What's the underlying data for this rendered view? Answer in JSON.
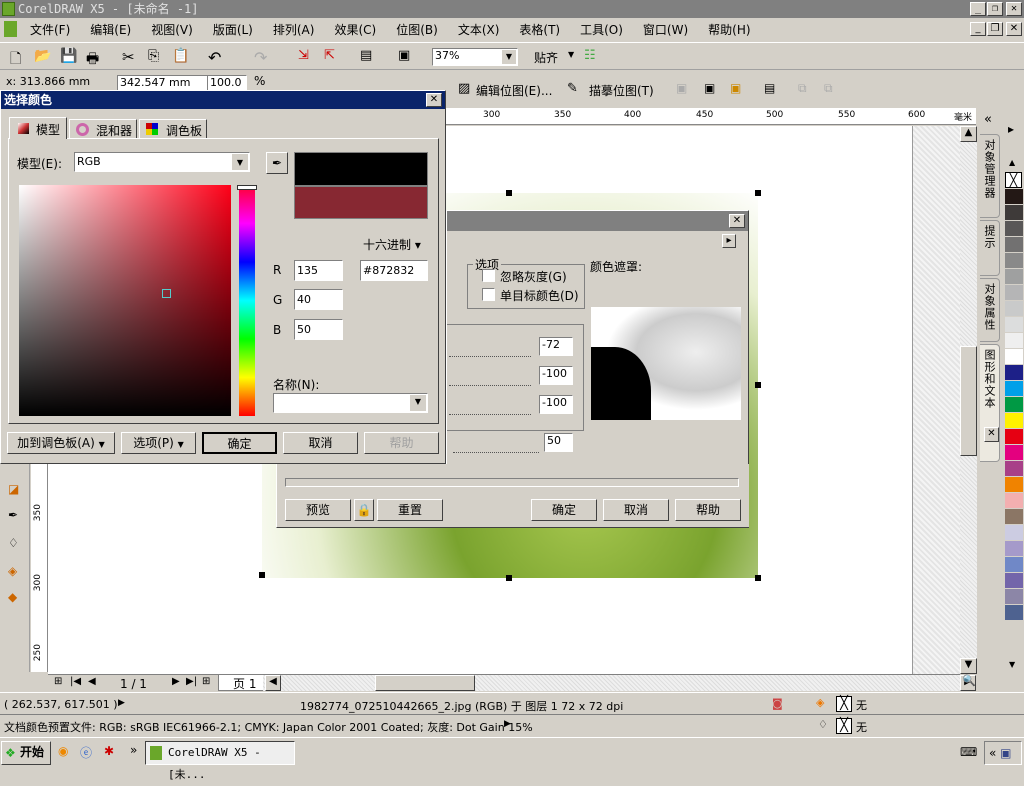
{
  "window": {
    "title": "CorelDRAW X5 - [未命名 -1]"
  },
  "menu": [
    "文件(F)",
    "编辑(E)",
    "视图(V)",
    "版面(L)",
    "排列(A)",
    "效果(C)",
    "位图(B)",
    "文本(X)",
    "表格(T)",
    "工具(O)",
    "窗口(W)",
    "帮助(H)"
  ],
  "toolbar": {
    "zoom": "37%",
    "snap": "贴齐"
  },
  "propbar": {
    "x": "x: 313.866 mm",
    "width": "342.547 mm",
    "scale": "100.0",
    "percent": "%",
    "edit_bitmap": "编辑位图(E)...",
    "trace_bitmap": "描摹位图(T)"
  },
  "ruler": {
    "top_ticks": [
      "300",
      "350",
      "400",
      "450",
      "500",
      "550",
      "600"
    ],
    "unit": "毫米",
    "left_ticks": [
      "350",
      "300",
      "250"
    ]
  },
  "color_dialog": {
    "title": "选择颜色",
    "tabs": [
      "模型",
      "混和器",
      "调色板"
    ],
    "model_label": "模型(E):",
    "model_value": "RGB",
    "hex_mode": "十六进制",
    "r_label": "R",
    "g_label": "G",
    "b_label": "B",
    "r": "135",
    "g": "40",
    "b": "50",
    "hex": "#872832",
    "name_label": "名称(N):",
    "name_value": "",
    "add_palette": "加到调色板(A)",
    "options": "选项(P)",
    "ok": "确定",
    "cancel": "取消",
    "help": "帮助",
    "old_color": "#000000",
    "new_color": "#872832"
  },
  "mask_dialog": {
    "options_group": "选项",
    "ignore_gray": "忽略灰度(G)",
    "single_target": "单目标颜色(D)",
    "color_mask": "颜色遮罩:",
    "values": [
      "-72",
      "-100",
      "-100"
    ],
    "tolerance": "50",
    "preview": "预览",
    "reset": "重置",
    "ok": "确定",
    "cancel": "取消",
    "help": "帮助"
  },
  "page_nav": {
    "page_count": "1 / 1",
    "page_tab": "页 1"
  },
  "dockers": [
    "对象管理器",
    "提示",
    "对象属性",
    "图形和文本"
  ],
  "palette": [
    "#231815",
    "#3e3a39",
    "#595757",
    "#727171",
    "#898989",
    "#9fa0a0",
    "#b5b5b6",
    "#c9caca",
    "#dcdddd",
    "#efefef",
    "#ffffff",
    "#1d2088",
    "#00a0e9",
    "#009944",
    "#fff100",
    "#e60012",
    "#e4007f",
    "#a84088",
    "#f08300",
    "#f3afb0",
    "#8b7665",
    "#cccce2",
    "#a59aca",
    "#7088c7",
    "#7365aa",
    "#8c86a7",
    "#4e6290"
  ],
  "status": {
    "coords": "( 262.537, 617.501 )",
    "object": "1982774_072510442665_2.jpg (RGB) 于 图层 1 72 x 72 dpi",
    "profile": "文档颜色预置文件: RGB: sRGB IEC61966-2.1; CMYK: Japan Color 2001 Coated; 灰度: Dot Gain 15%",
    "fill": "无",
    "outline": "无"
  },
  "taskbar": {
    "start": "开始",
    "task": "CorelDRAW X5 - [未..."
  }
}
